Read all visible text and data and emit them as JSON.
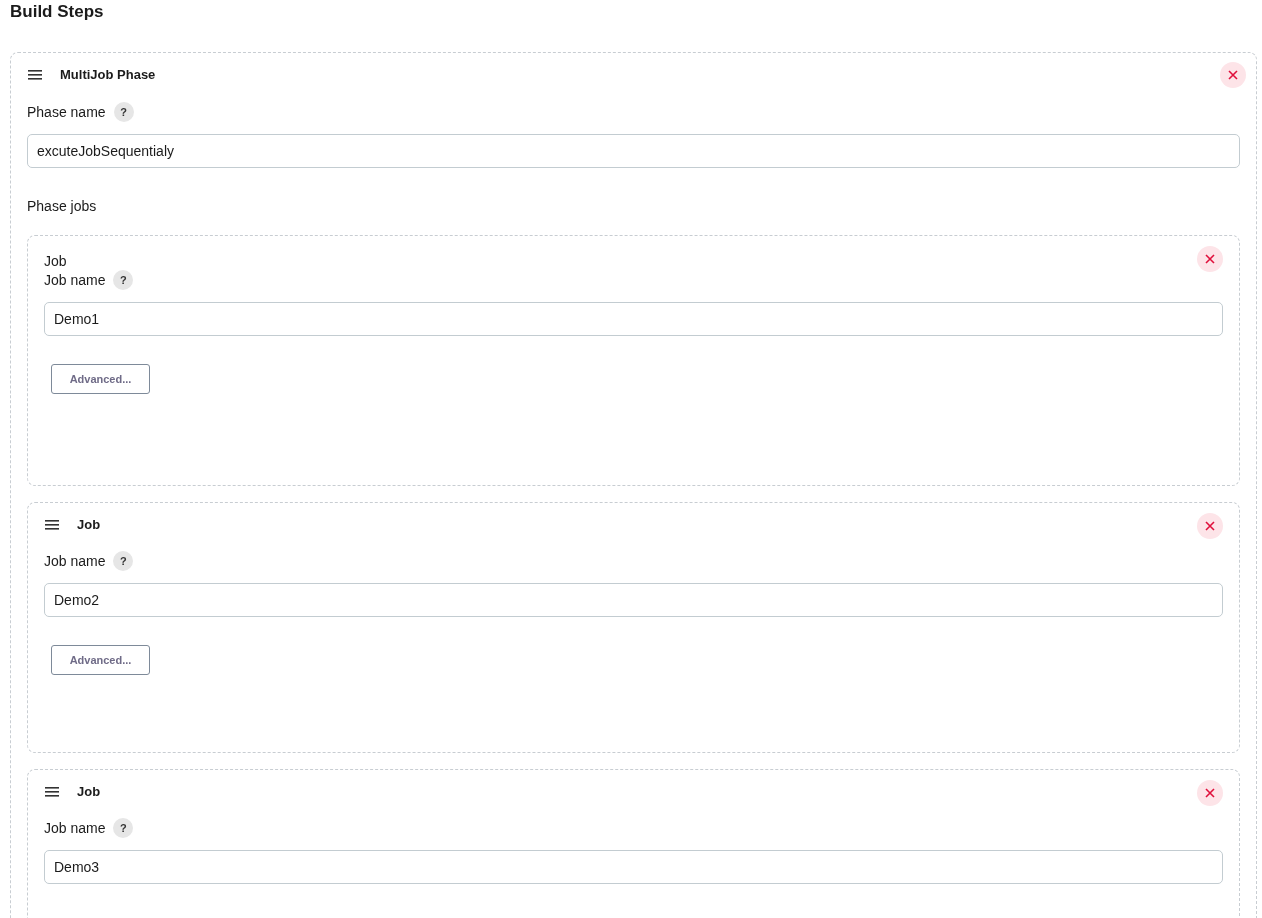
{
  "heading": "Build Steps",
  "phase": {
    "title": "MultiJob Phase",
    "name_label": "Phase name",
    "help": "?",
    "name_value": "excuteJobSequentialy",
    "jobs_label": "Phase jobs",
    "jobs": [
      {
        "kind": "plain",
        "title": "Job",
        "name_label": "Job name",
        "help": "?",
        "value": "Demo1",
        "advanced": "Advanced..."
      },
      {
        "kind": "handle",
        "title": "Job",
        "name_label": "Job name",
        "help": "?",
        "value": "Demo2",
        "advanced": "Advanced..."
      },
      {
        "kind": "handle",
        "title": "Job",
        "name_label": "Job name",
        "help": "?",
        "value": "Demo3"
      }
    ]
  }
}
